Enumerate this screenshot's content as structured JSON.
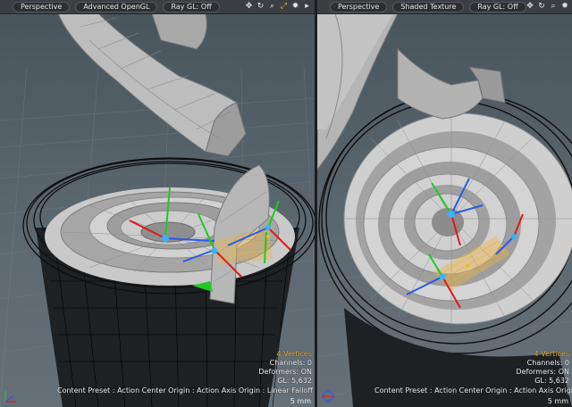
{
  "left_viewport": {
    "view_mode": "Perspective",
    "render_mode": "Advanced OpenGL",
    "raygl": "Ray GL: Off",
    "icons": [
      "move-view-icon",
      "rotate-view-icon",
      "zoom-view-icon",
      "maximize-view-icon",
      "settings-gear-icon",
      "expand-arrow-icon"
    ],
    "hud": {
      "selection": "4 Vertices",
      "channels": "Channels: 0",
      "deformers": "Deformers: ON",
      "gl": "GL: 5,632"
    },
    "status": "Content Preset : Action Center Origin : Action Axis Origin : Linear Falloff : Lasso",
    "scale": "5 mm"
  },
  "right_viewport": {
    "view_mode": "Perspective",
    "render_mode": "Shaded Texture",
    "raygl": "Ray GL: Off",
    "icons": [
      "move-view-icon",
      "rotate-view-icon",
      "zoom-view-icon",
      "settings-gear-icon",
      "expand-arrow-icon"
    ],
    "hud": {
      "selection": "4 Vertices",
      "channels": "Channels: 0",
      "deformers": "Deformers: ON",
      "gl": "GL: 5,632"
    },
    "status": "Content Preset : Action Center Origin : Action Axis Origin : Linear Falloff : Lasso",
    "scale": "5 mm"
  },
  "colors": {
    "background_top": "#47545c",
    "background_bottom": "#667079",
    "mesh": "#bdbdbd",
    "wire": "#111111",
    "gizmo_x": "#e01818",
    "gizmo_y": "#22c822",
    "gizmo_z": "#2a5ae6",
    "selection": "#f0b43c"
  }
}
